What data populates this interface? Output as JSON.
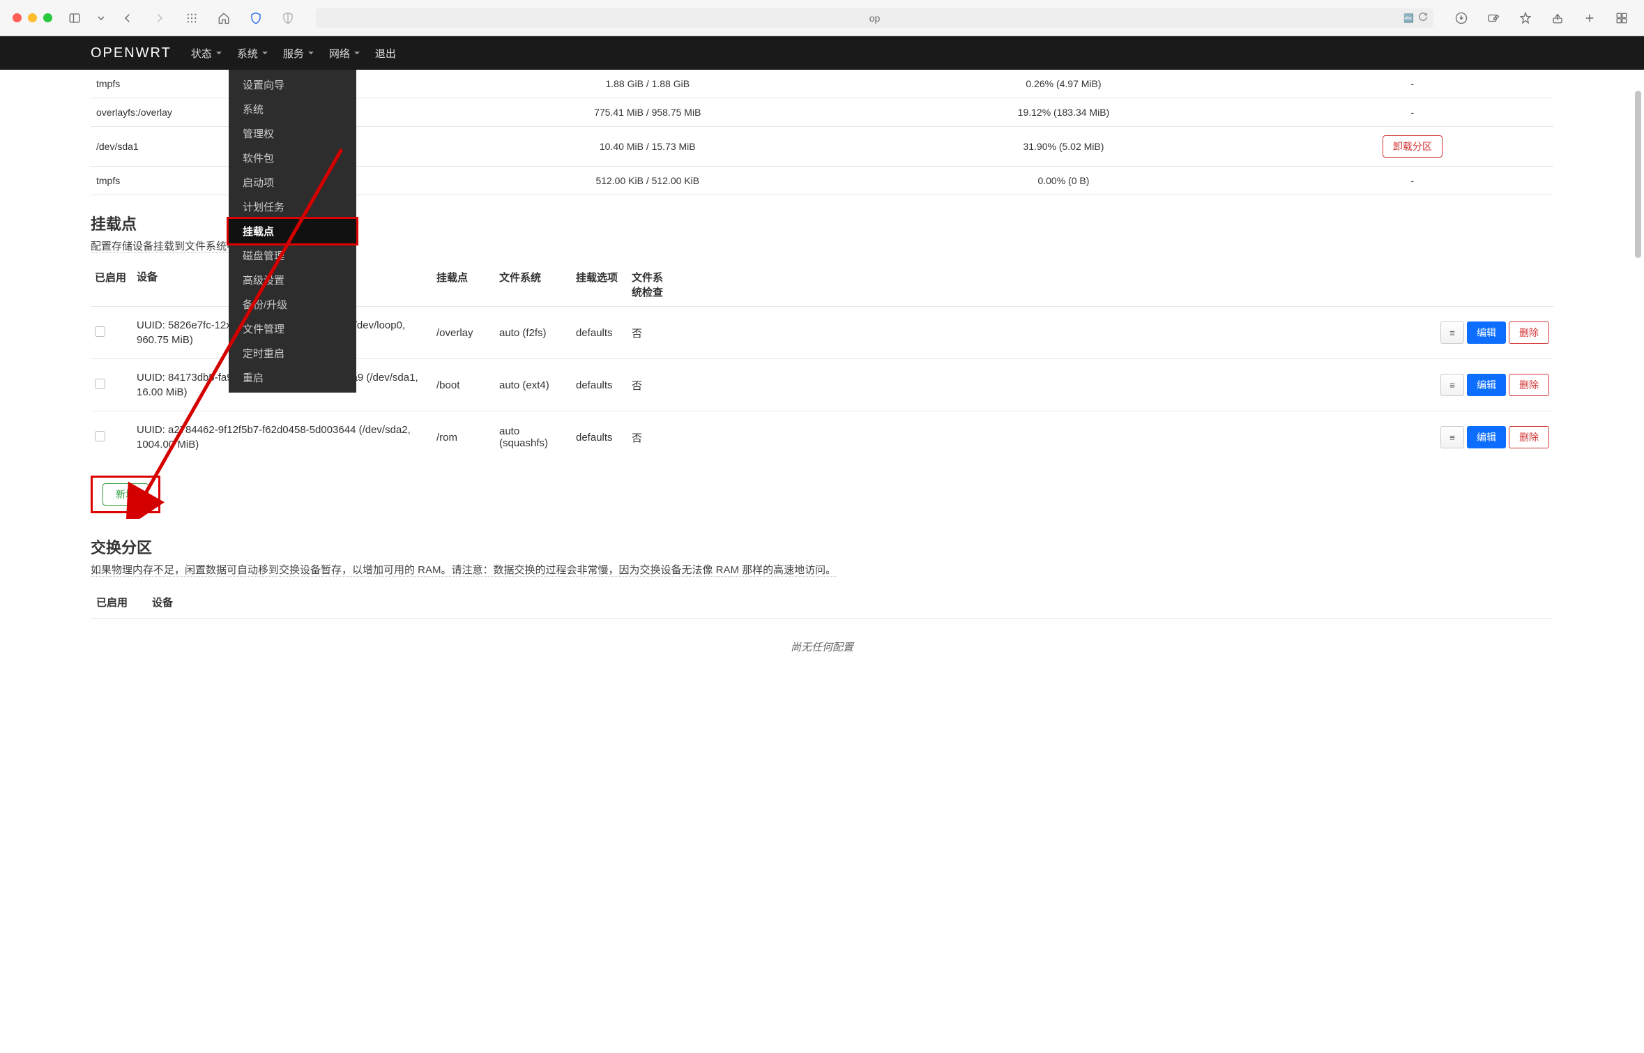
{
  "chrome": {
    "address_text": "op"
  },
  "header": {
    "logo": "OPENWRT",
    "nav": [
      "状态",
      "系统",
      "服务",
      "网络",
      "退出"
    ]
  },
  "dropdown": {
    "items": [
      "设置向导",
      "系统",
      "管理权",
      "软件包",
      "启动项",
      "计划任务",
      "挂载点",
      "磁盘管理",
      "高级设置",
      "备份/升级",
      "文件管理",
      "定时重启",
      "重启"
    ],
    "highlighted_index": 6
  },
  "fs_rows": [
    {
      "name": "tmpfs",
      "usage": "1.88 GiB / 1.88 GiB",
      "pct": "0.26% (4.97 MiB)",
      "action": "-"
    },
    {
      "name": "overlayfs:/overlay",
      "usage": "775.41 MiB / 958.75 MiB",
      "pct": "19.12% (183.34 MiB)",
      "action": "-"
    },
    {
      "name": "/dev/sda1",
      "usage": "10.40 MiB / 15.73 MiB",
      "pct": "31.90% (5.02 MiB)",
      "action_btn": "卸载分区"
    },
    {
      "name": "tmpfs",
      "usage": "512.00 KiB / 512.00 KiB",
      "pct": "0.00% (0 B)",
      "action": "-"
    }
  ],
  "mounts": {
    "heading": "挂载点",
    "desc": "配置存储设备挂载到文件系统中的位置和方式。",
    "cols": {
      "enable": "已启用",
      "device": "设备",
      "mount": "挂载点",
      "fs": "文件系统",
      "opts": "挂载选项",
      "check": "文件系统检查"
    },
    "rows": [
      {
        "device": "UUID: 5826e7fc-12xx-xxxx-xxxx-xxxxxxxx5c1 (/dev/loop0, 960.75 MiB)",
        "mount": "/overlay",
        "fs": "auto (f2fs)",
        "opts": "defaults",
        "check": "否"
      },
      {
        "device": "UUID: 84173db5-fa99-e35a-95c6-28613cc79ea9 (/dev/sda1, 16.00 MiB)",
        "mount": "/boot",
        "fs": "auto (ext4)",
        "opts": "defaults",
        "check": "否"
      },
      {
        "device": "UUID: a2784462-9f12f5b7-f62d0458-5d003644 (/dev/sda2, 1004.00 MiB)",
        "mount": "/rom",
        "fs": "auto (squashfs)",
        "opts": "defaults",
        "check": "否"
      }
    ],
    "btn_drag": "≡",
    "btn_edit": "编辑",
    "btn_delete": "删除",
    "btn_add": "新增"
  },
  "swap": {
    "heading": "交换分区",
    "desc": "如果物理内存不足，闲置数据可自动移到交换设备暂存，以增加可用的 RAM。请注意：数据交换的过程会非常慢，因为交换设备无法像 RAM 那样的高速地访问。",
    "cols": {
      "enable": "已启用",
      "device": "设备"
    },
    "no_config": "尚无任何配置"
  }
}
